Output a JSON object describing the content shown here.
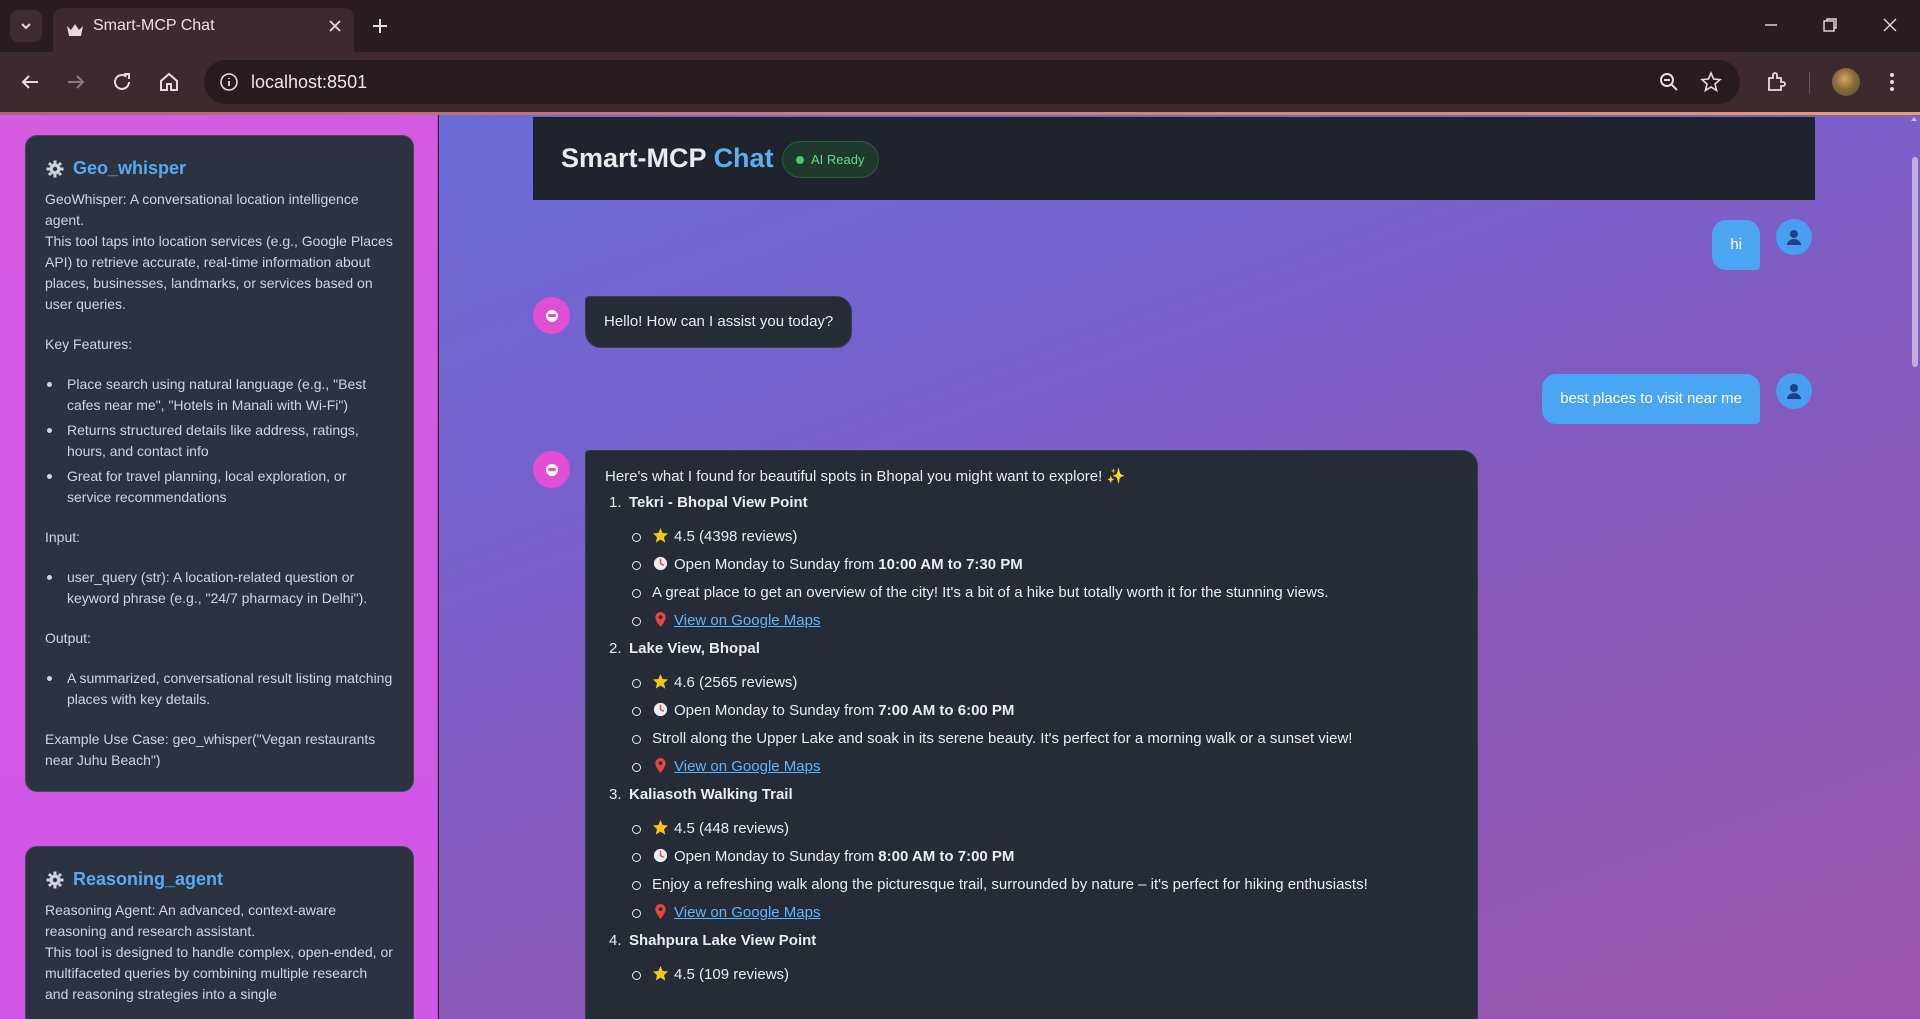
{
  "browser": {
    "tab_title": "Smart-MCP Chat",
    "url": "localhost:8501",
    "accent": "#e3a06a"
  },
  "sidebar": {
    "tools": [
      {
        "name": "Geo_whisper",
        "icon": "gear-icon",
        "intro_1": "GeoWhisper: A conversational location intelligence agent.",
        "intro_2": "This tool taps into location services (e.g., Google Places API) to retrieve accurate, real-time information about places, businesses, landmarks, or services based on user queries.",
        "features_label": "Key Features:",
        "features": [
          "Place search using natural language (e.g., \"Best cafes near me\", \"Hotels in Manali with Wi-Fi\")",
          "Returns structured details like address, ratings, hours, and contact info",
          "Great for travel planning, local exploration, or service recommendations"
        ],
        "input_label": "Input:",
        "inputs": [
          "user_query (str): A location-related question or keyword phrase (e.g., \"24/7 pharmacy in Delhi\")."
        ],
        "output_label": "Output:",
        "outputs": [
          "A summarized, conversational result listing matching places with key details."
        ],
        "example": "Example Use Case: geo_whisper(\"Vegan restaurants near Juhu Beach\")"
      },
      {
        "name": "Reasoning_agent",
        "icon": "gear-icon",
        "intro_1": "Reasoning Agent: An advanced, context-aware reasoning and research assistant.",
        "intro_2": "This tool is designed to handle complex, open-ended, or multifaceted queries by combining multiple research and reasoning strategies into a single"
      }
    ]
  },
  "header": {
    "title_part1": "Smart-MCP",
    "title_part2": "Chat",
    "status": "AI Ready",
    "status_color": "#4fc46e"
  },
  "chat": {
    "messages": [
      {
        "role": "user",
        "text": "hi"
      },
      {
        "role": "assistant",
        "text": "Hello! How can I assist you today?"
      },
      {
        "role": "user",
        "text": "best places to visit near me"
      }
    ],
    "response": {
      "intro": "Here's what I found for beautiful spots in Bhopal you might want to explore! ✨",
      "places": [
        {
          "num": "1.",
          "name": "Tekri - Bhopal View Point",
          "rating": "4.5 (4398 reviews)",
          "hours_prefix": "Open Monday to Sunday from ",
          "hours": "10:00 AM to 7:30 PM",
          "description": "A great place to get an overview of the city! It's a bit of a hike but totally worth it for the stunning views.",
          "link": "View on Google Maps"
        },
        {
          "num": "2.",
          "name": "Lake View, Bhopal",
          "rating": "4.6 (2565 reviews)",
          "hours_prefix": "Open Monday to Sunday from ",
          "hours": "7:00 AM to 6:00 PM",
          "description": "Stroll along the Upper Lake and soak in its serene beauty. It's perfect for a morning walk or a sunset view!",
          "link": "View on Google Maps"
        },
        {
          "num": "3.",
          "name": "Kaliasoth Walking Trail",
          "rating": "4.5 (448 reviews)",
          "hours_prefix": "Open Monday to Sunday from ",
          "hours": "8:00 AM to 7:00 PM",
          "description": "Enjoy a refreshing walk along the picturesque trail, surrounded by nature – it's perfect for hiking enthusiasts!",
          "link": "View on Google Maps"
        },
        {
          "num": "4.",
          "name": "Shahpura Lake View Point",
          "rating": "4.5 (109 reviews)"
        }
      ]
    }
  }
}
